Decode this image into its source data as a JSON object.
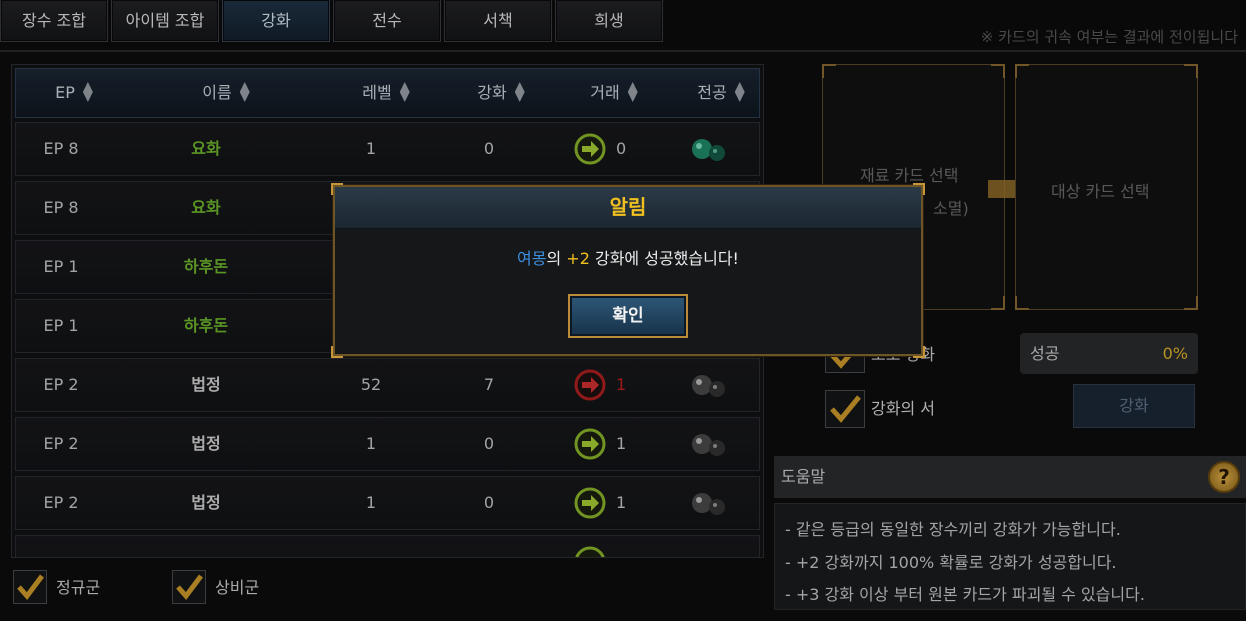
{
  "tabs": [
    {
      "label": "장수 조합",
      "active": false
    },
    {
      "label": "아이템 조합",
      "active": false
    },
    {
      "label": "강화",
      "active": true
    },
    {
      "label": "전수",
      "active": false
    },
    {
      "label": "서책",
      "active": false
    },
    {
      "label": "희생",
      "active": false
    }
  ],
  "notice": "※ 카드의 귀속 여부는 결과에 전이됩니다",
  "table": {
    "headers": [
      "EP",
      "이름",
      "레벨",
      "강화",
      "거래",
      "전공"
    ],
    "rows": [
      {
        "ep": "EP 8",
        "name": "요화",
        "level": "1",
        "enhance": "0",
        "trade": "0",
        "trade_status": "available",
        "gem": "green-gem-icon"
      },
      {
        "ep": "EP 8",
        "name": "요화",
        "level": "",
        "enhance": "",
        "trade": "",
        "trade_status": "",
        "gem": ""
      },
      {
        "ep": "EP 1",
        "name": "하후돈",
        "level": "",
        "enhance": "",
        "trade": "",
        "trade_status": "",
        "gem": ""
      },
      {
        "ep": "EP 1",
        "name": "하후돈",
        "level": "",
        "enhance": "",
        "trade": "",
        "trade_status": "",
        "gem": ""
      },
      {
        "ep": "EP 2",
        "name": "법정",
        "level": "52",
        "enhance": "7",
        "trade": "1",
        "trade_status": "locked",
        "gem": "gray-gem-icon"
      },
      {
        "ep": "EP 2",
        "name": "법정",
        "level": "1",
        "enhance": "0",
        "trade": "1",
        "trade_status": "available",
        "gem": "gray-gem-icon"
      },
      {
        "ep": "EP 2",
        "name": "법정",
        "level": "1",
        "enhance": "0",
        "trade": "1",
        "trade_status": "available",
        "gem": "gray-gem-icon"
      }
    ]
  },
  "filters": {
    "regular": "정규군",
    "irregular": "상비군"
  },
  "material_card": {
    "line1": "재료 카드 선택",
    "line2": "소멸)"
  },
  "target_card": {
    "label": "대상 카드 선택"
  },
  "auto_enhance": {
    "label": "오보 강화"
  },
  "success": {
    "label": "성공",
    "value": "0%"
  },
  "enhance_book": {
    "label": "강화의 서"
  },
  "enhance_button": "강화",
  "help": {
    "title": "도움말",
    "lines": [
      "- 같은 등급의 동일한 장수끼리 강화가 가능합니다.",
      "- +2 강화까지 100% 확률로 강화가 성공합니다.",
      "- +3 강화 이상 부터 원본 카드가 파괴될 수 있습니다."
    ]
  },
  "modal": {
    "title": "알림",
    "name": "여몽",
    "particle": "의 ",
    "level": "+2",
    "rest": " 강화에 성공했습니다!",
    "ok": "확인"
  },
  "colors": {
    "accent_gold": "#f0c020",
    "name_green": "#6fb82c",
    "trade_red": "#c41e1e",
    "link_blue": "#3d8fe0"
  }
}
